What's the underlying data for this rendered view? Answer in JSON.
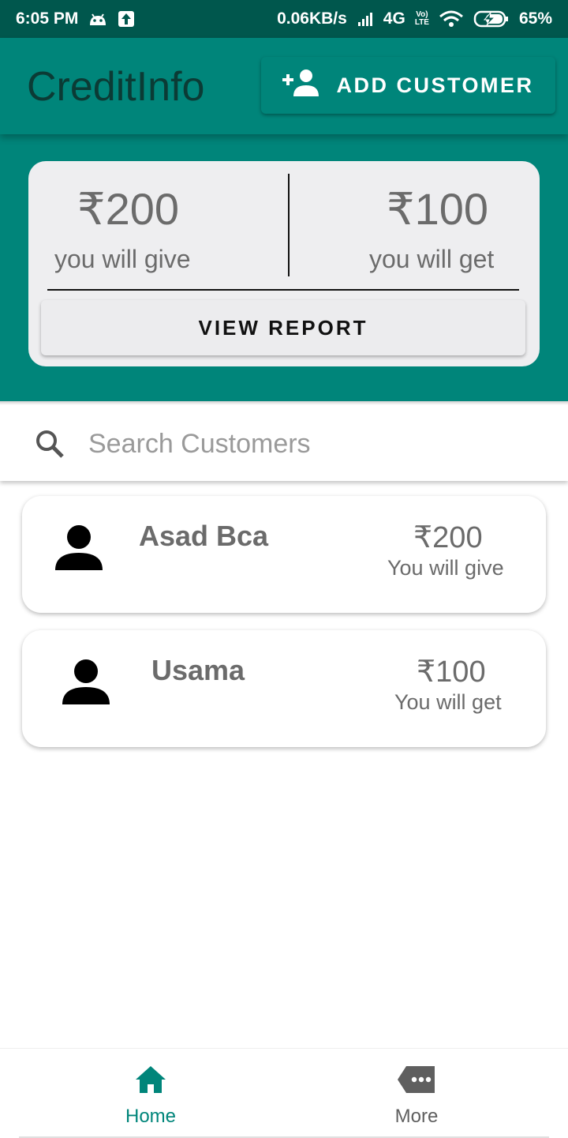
{
  "status_bar": {
    "time": "6:05 PM",
    "net_speed": "0.06KB/s",
    "network": "4G",
    "volte_top": "Vo)",
    "volte_bottom": "LTE",
    "battery": "65%"
  },
  "app_bar": {
    "title": "CreditInfo",
    "add_customer_label": "ADD CUSTOMER"
  },
  "summary": {
    "give_amount": "₹200",
    "give_label": "you will give",
    "get_amount": "₹100",
    "get_label": "you will get",
    "report_button": "VIEW REPORT"
  },
  "search": {
    "placeholder": "Search Customers",
    "value": ""
  },
  "customers": [
    {
      "name": "Asad Bca",
      "amount": "₹200",
      "status": "You will give"
    },
    {
      "name": "Usama",
      "amount": "₹100",
      "status": "You will get"
    }
  ],
  "bottom_nav": {
    "home_label": "Home",
    "more_label": "More"
  },
  "colors": {
    "primary": "#00857a",
    "status_bar": "#00574d",
    "active_nav": "#00857a",
    "inactive_nav": "#5f5f5f"
  },
  "icons": [
    "android-icon",
    "upload-icon",
    "signal-icon",
    "wifi-icon",
    "battery-icon",
    "add-person-icon",
    "search-icon",
    "person-icon",
    "home-icon",
    "more-icon"
  ]
}
